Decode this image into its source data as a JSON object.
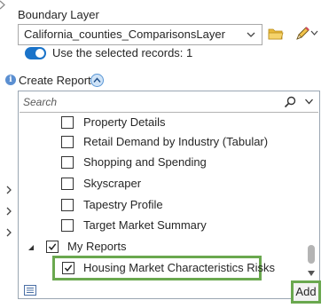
{
  "boundary": {
    "label": "Boundary Layer",
    "selected_layer": "California_counties_ComparisonsLayer",
    "use_selected_label": "Use the selected records: 1",
    "use_selected_on": true
  },
  "create_reports": {
    "label": "Create Reports",
    "search_placeholder": "Search",
    "items": [
      {
        "label": "Property Details",
        "checked": false
      },
      {
        "label": "Retail Demand by Industry (Tabular)",
        "checked": false
      },
      {
        "label": "Shopping and Spending",
        "checked": false
      },
      {
        "label": "Skyscraper",
        "checked": false
      },
      {
        "label": "Tapestry Profile",
        "checked": false
      },
      {
        "label": "Target Market Summary",
        "checked": false
      }
    ],
    "my_reports": {
      "label": "My Reports",
      "checked": true,
      "items": [
        {
          "label": "Housing Market Characteristics Risks",
          "checked": true
        }
      ]
    }
  },
  "footer": {
    "add_label": "Add"
  },
  "colors": {
    "accent": "#1a73c9",
    "highlight": "#6aa84f",
    "folder": "#e8b93b"
  }
}
